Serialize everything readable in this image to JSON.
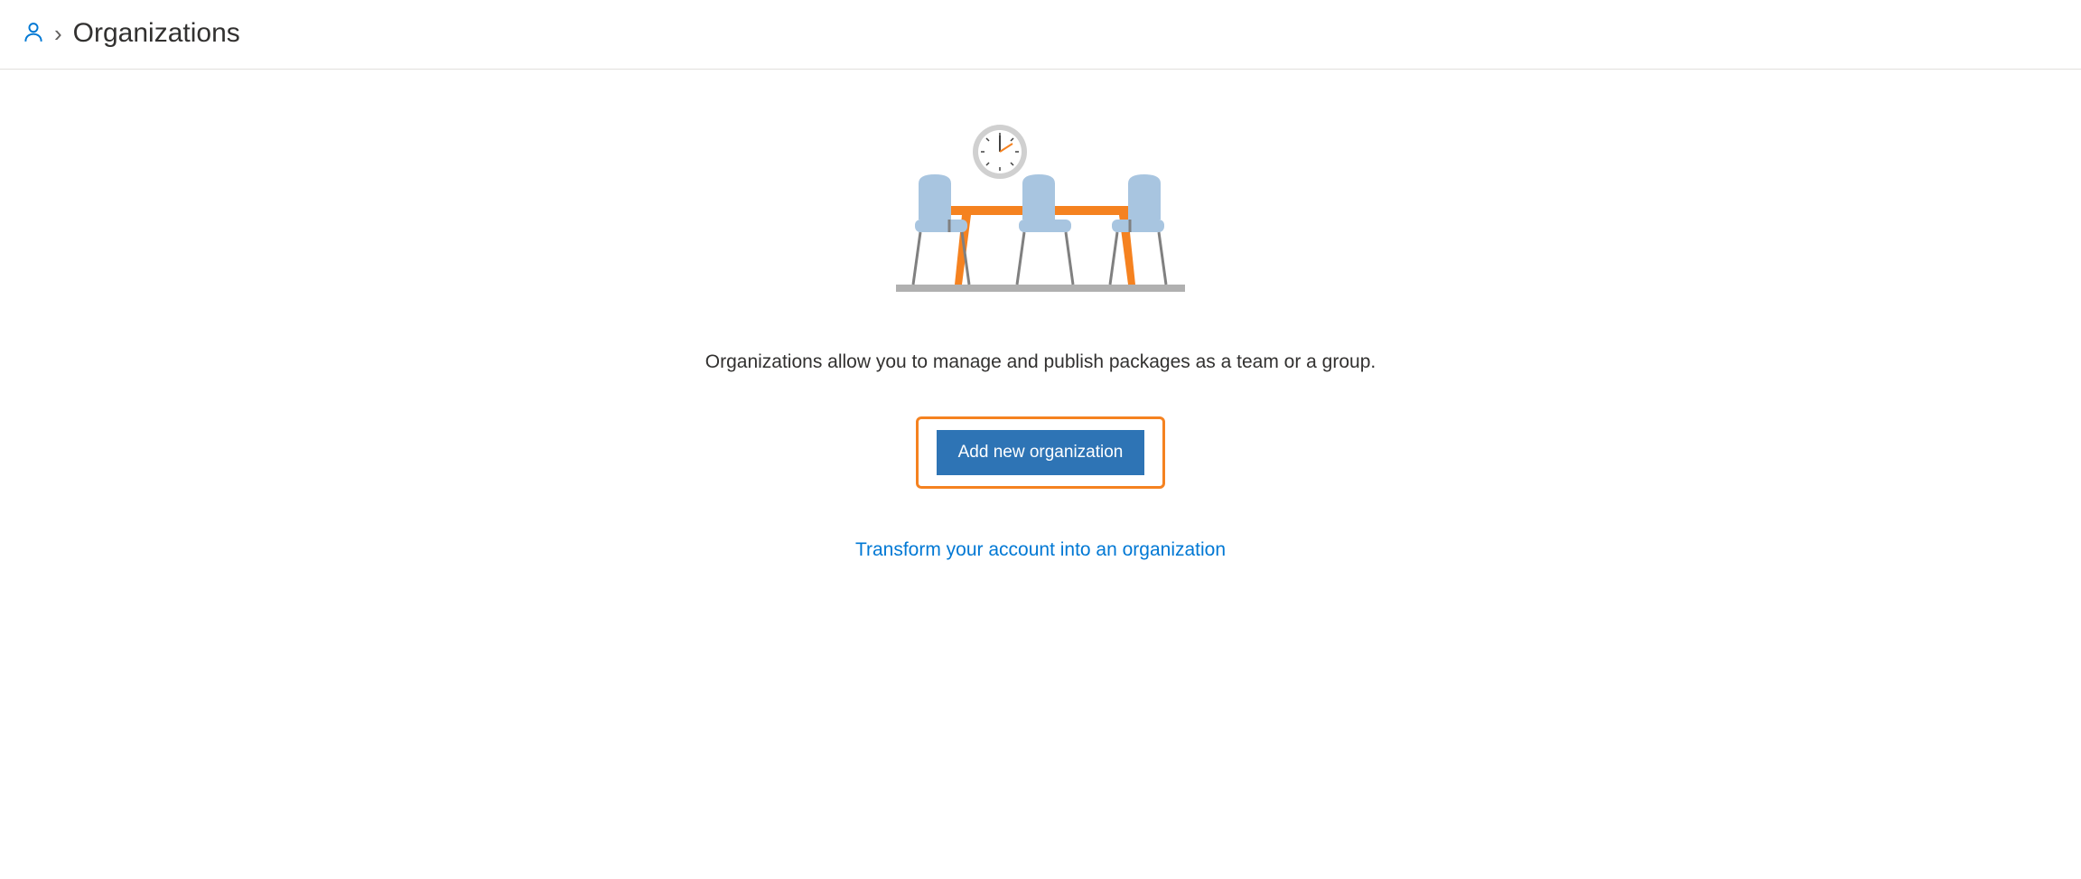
{
  "breadcrumb": {
    "title": "Organizations"
  },
  "main": {
    "description": "Organizations allow you to manage and publish packages as a team or a group.",
    "add_button_label": "Add new organization",
    "transform_link_label": "Transform your account into an organization"
  }
}
